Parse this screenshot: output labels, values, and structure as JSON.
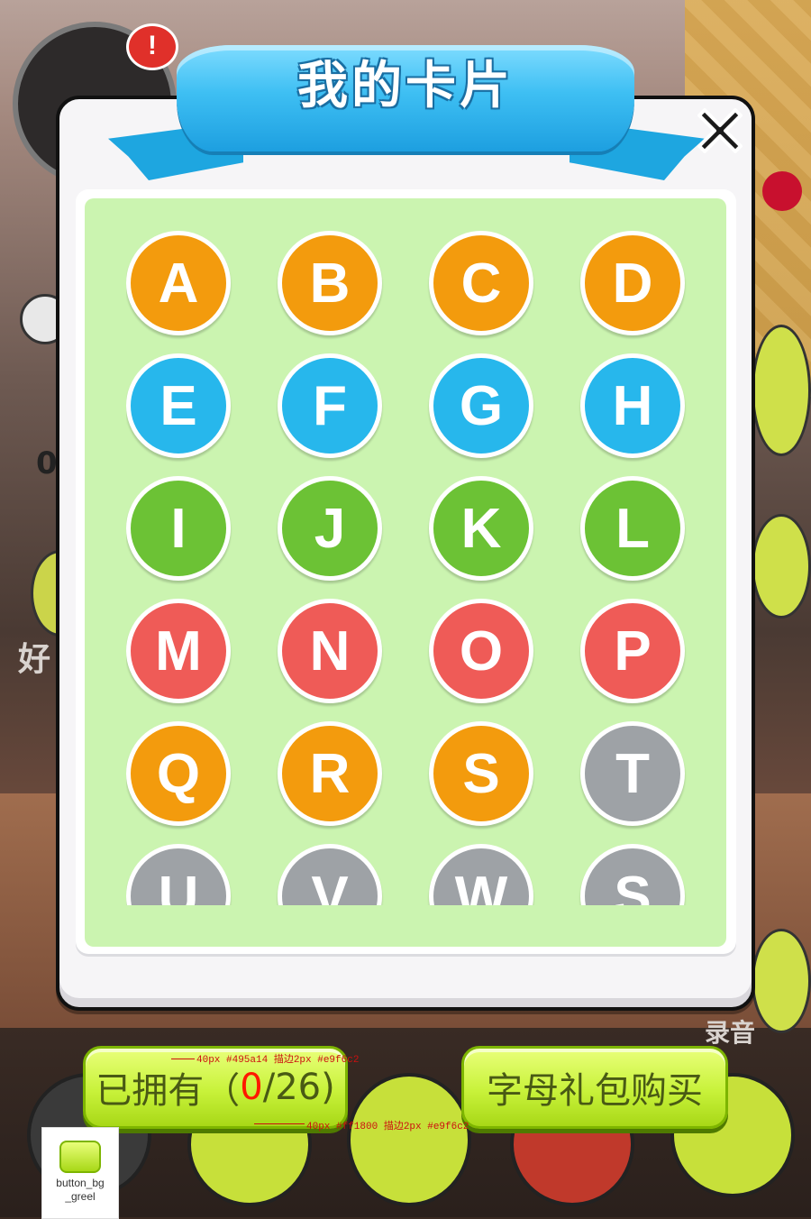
{
  "colors": {
    "orange": "#f39b0d",
    "blue": "#27b7ec",
    "green": "#6cc235",
    "red": "#ef5b57",
    "gray": "#9ea2a6",
    "grid_bg": "#cbf4b0",
    "button_text": "#495a14",
    "count_red": "#ff1800",
    "ribbon": "#3ebff3"
  },
  "dialog": {
    "title": "我的卡片",
    "close_icon": "close-x-icon"
  },
  "cards": [
    {
      "letter": "A",
      "color": "orange"
    },
    {
      "letter": "B",
      "color": "orange"
    },
    {
      "letter": "C",
      "color": "orange"
    },
    {
      "letter": "D",
      "color": "orange"
    },
    {
      "letter": "E",
      "color": "blue"
    },
    {
      "letter": "F",
      "color": "blue"
    },
    {
      "letter": "G",
      "color": "blue"
    },
    {
      "letter": "H",
      "color": "blue"
    },
    {
      "letter": "I",
      "color": "green"
    },
    {
      "letter": "J",
      "color": "green"
    },
    {
      "letter": "K",
      "color": "green"
    },
    {
      "letter": "L",
      "color": "green"
    },
    {
      "letter": "M",
      "color": "red"
    },
    {
      "letter": "N",
      "color": "red"
    },
    {
      "letter": "O",
      "color": "red"
    },
    {
      "letter": "P",
      "color": "red"
    },
    {
      "letter": "Q",
      "color": "orange"
    },
    {
      "letter": "R",
      "color": "orange"
    },
    {
      "letter": "S",
      "color": "orange"
    },
    {
      "letter": "T",
      "color": "gray"
    },
    {
      "letter": "U",
      "color": "gray"
    },
    {
      "letter": "V",
      "color": "gray"
    },
    {
      "letter": "W",
      "color": "gray"
    },
    {
      "letter": "S",
      "color": "gray"
    }
  ],
  "buttons": {
    "owned_prefix": "已拥有（",
    "owned_count": "0",
    "owned_suffix": "/26)",
    "buy_label": "字母礼包购买"
  },
  "annotations": {
    "top": "40px #495a14 描边2px #e9f6c2",
    "bottom": "40px #ff1800 描边2px #e9f6c2"
  },
  "legend": {
    "caption_line1": "button_bg",
    "caption_line2": "_greel"
  },
  "background": {
    "alert": "!",
    "left_label": "好",
    "right_label": "录音",
    "left_number": "0"
  }
}
